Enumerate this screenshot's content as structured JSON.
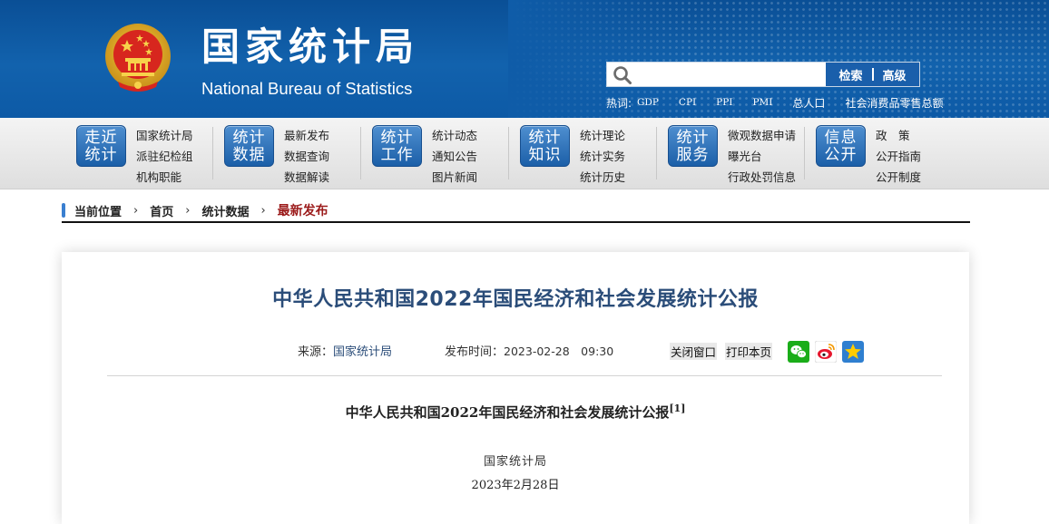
{
  "header": {
    "title_cn": "国家统计局",
    "title_en": "National Bureau of Statistics",
    "search": {
      "placeholder": "",
      "search_label": "检索",
      "advanced_label": "高级"
    },
    "hot_label": "热词:",
    "hot_words": [
      "GDP",
      "CPI",
      "PPI",
      "PMI",
      "总人口",
      "社会消费品零售总额"
    ]
  },
  "nav": {
    "groups": [
      {
        "badge_line1": "走近",
        "badge_line2": "统计",
        "links": [
          "国家统计局",
          "派驻纪检组",
          "机构职能"
        ]
      },
      {
        "badge_line1": "统计",
        "badge_line2": "数据",
        "links": [
          "最新发布",
          "数据查询",
          "数据解读"
        ]
      },
      {
        "badge_line1": "统计",
        "badge_line2": "工作",
        "links": [
          "统计动态",
          "通知公告",
          "图片新闻"
        ]
      },
      {
        "badge_line1": "统计",
        "badge_line2": "知识",
        "links": [
          "统计理论",
          "统计实务",
          "统计历史"
        ]
      },
      {
        "badge_line1": "统计",
        "badge_line2": "服务",
        "links": [
          "微观数据申请",
          "曝光台",
          "行政处罚信息"
        ]
      },
      {
        "badge_line1": "信息",
        "badge_line2": "公开",
        "links": [
          "政　策",
          "公开指南",
          "公开制度"
        ]
      }
    ]
  },
  "breadcrumb": {
    "label": "当前位置",
    "items": [
      "首页",
      "统计数据",
      "最新发布"
    ]
  },
  "article": {
    "title": "中华人民共和国2022年国民经济和社会发展统计公报",
    "source_label": "来源：",
    "source_value": "国家统计局",
    "time_label": "发布时间：",
    "time_value": "2023-02-28　09:30",
    "close_label": "关闭窗口",
    "print_label": "打印本页",
    "body_title": "中华人民共和国2022年国民经济和社会发展统计公报",
    "body_title_note": "[1]",
    "body_author": "国家统计局",
    "body_date": "2023年2月28日"
  },
  "colors": {
    "header_blue": "#1262ad",
    "nav_badge_blue": "#1b5fa8",
    "title_blue": "#2b4d79",
    "breadcrumb_current": "#9b1a1a"
  },
  "icons": [
    "national-emblem-icon",
    "search-icon",
    "wechat-icon",
    "weibo-icon",
    "qzone-icon"
  ]
}
